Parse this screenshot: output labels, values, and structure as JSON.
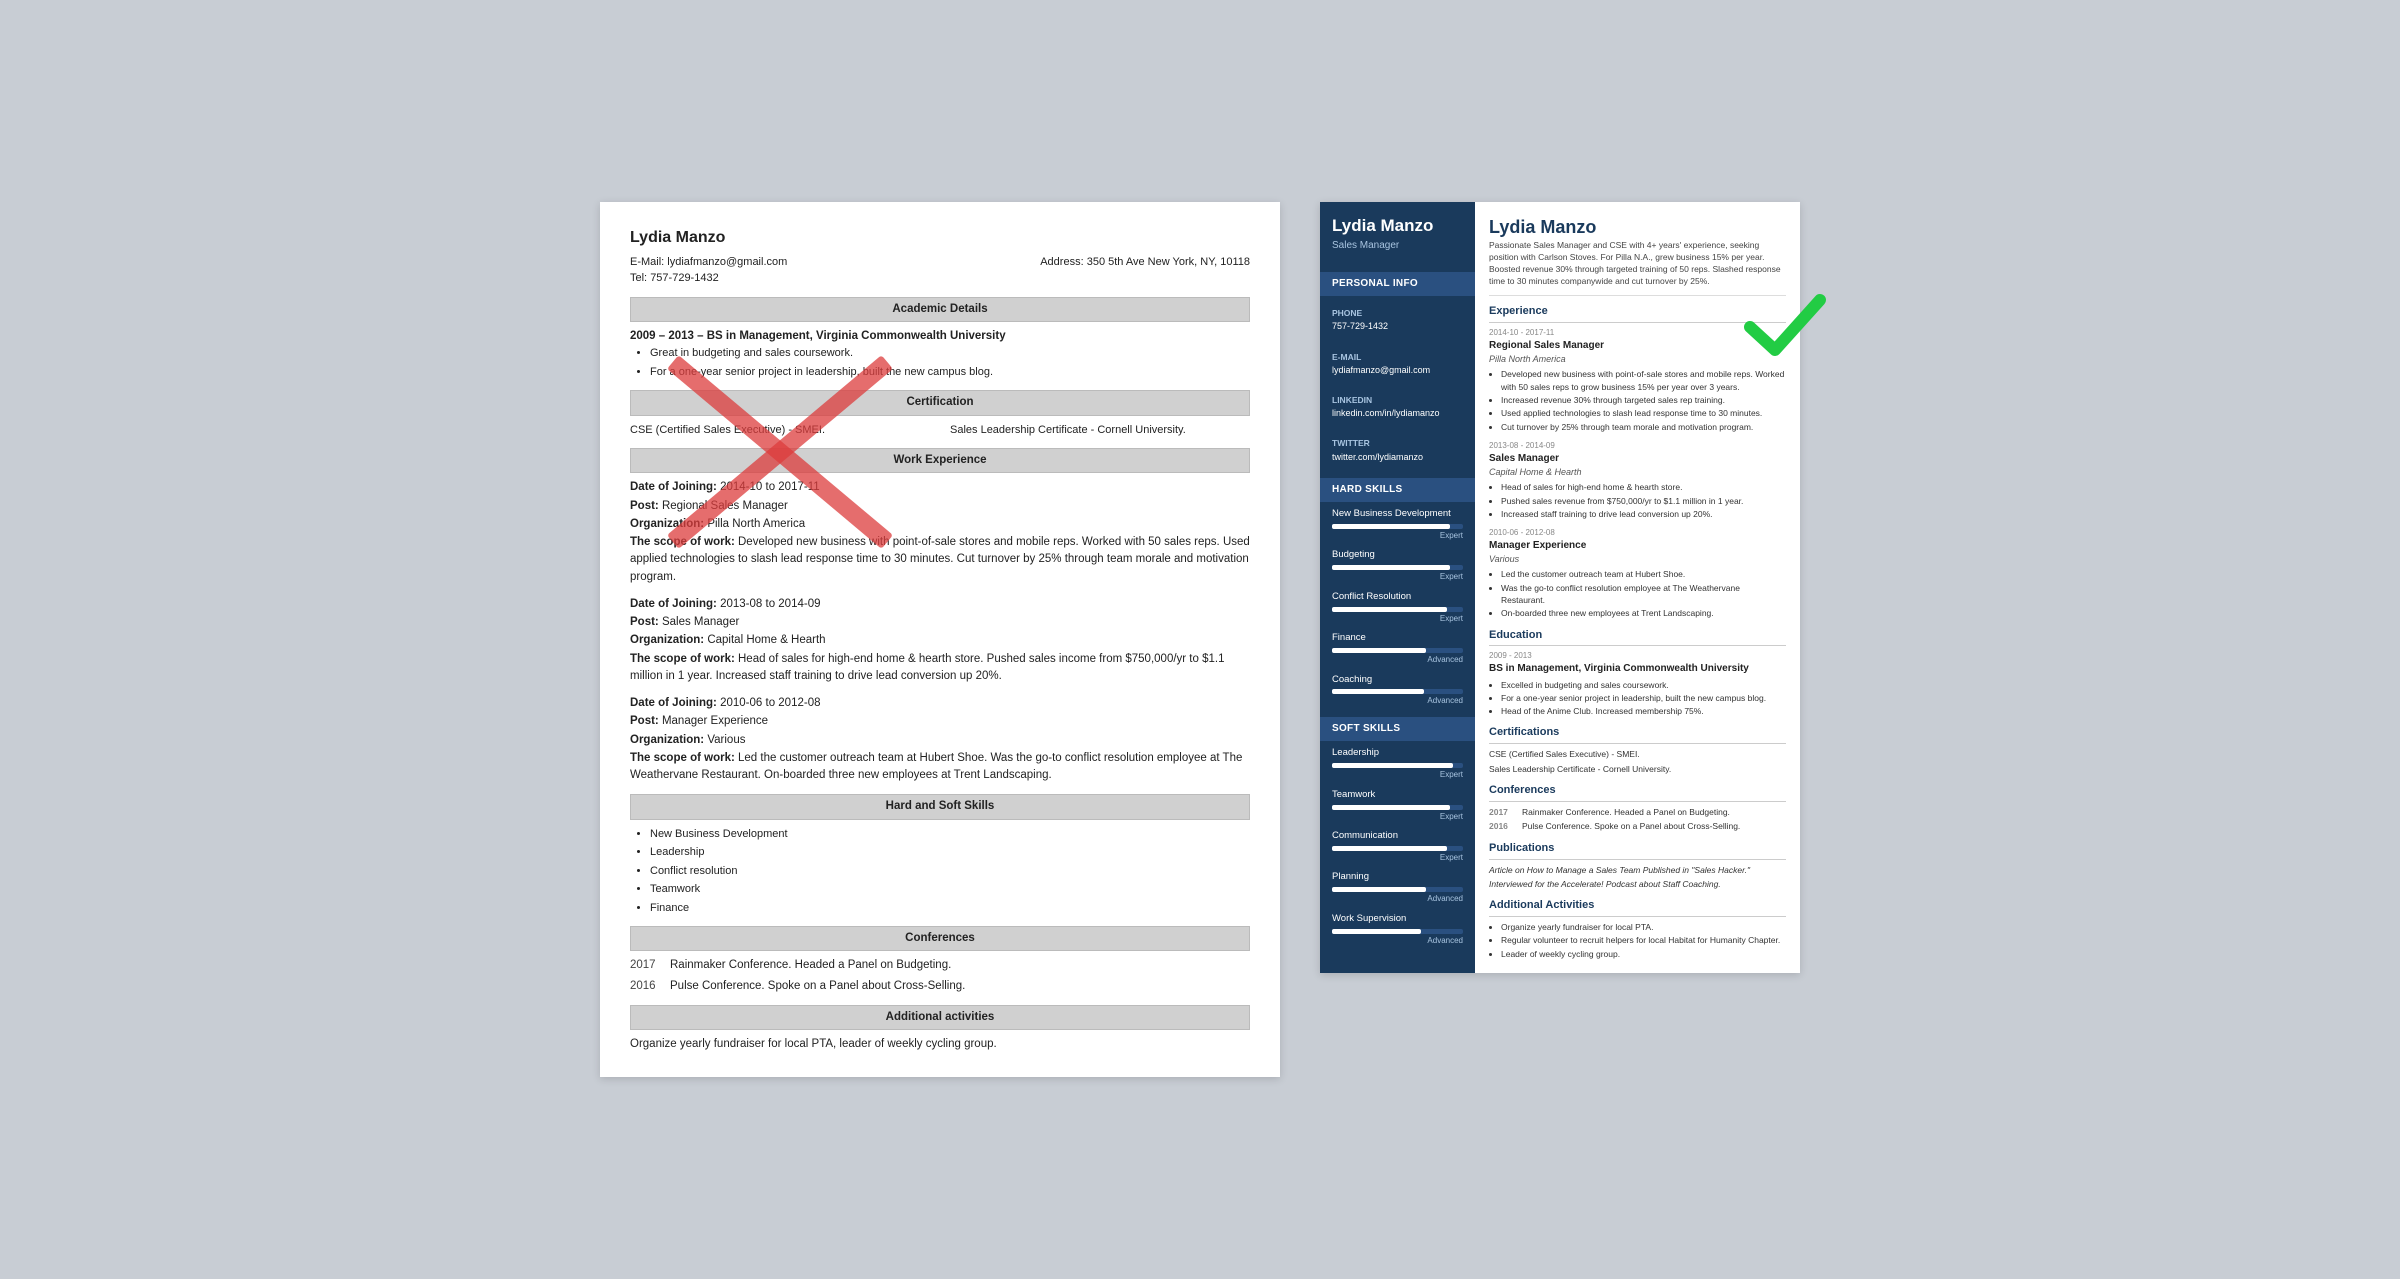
{
  "left_resume": {
    "name": "Lydia Manzo",
    "email_label": "E-Mail:",
    "email": "lydiafmanzo@gmail.com",
    "address_label": "Address:",
    "address": "350 5th Ave New York, NY, 10118",
    "tel_label": "Tel:",
    "tel": "757-729-1432",
    "sections": {
      "academic": "Academic Details",
      "certification": "Certification",
      "work": "Work Experience",
      "skills": "Hard and Soft Skills",
      "conferences": "Conferences",
      "activities": "Additional activities"
    },
    "edu": {
      "dates": "2009 – 2013",
      "degree": "BS in Management, Virginia Commonwealth University",
      "bullets": [
        "Great in budgeting and sales coursework.",
        "For a one-year senior project in leadership, built the new campus blog."
      ]
    },
    "certs": [
      "CSE (Certified Sales Executive) - SMEI.",
      "Sales Leadership Certificate - Cornell University."
    ],
    "work": [
      {
        "date_label": "Date of Joining:",
        "dates": "2014-10 to 2017-11",
        "post_label": "Post:",
        "post": "Regional Sales Manager",
        "org_label": "Organization:",
        "org": "Pilla North America",
        "scope_label": "The scope of work:",
        "scope": "Developed new business with point-of-sale stores and mobile reps. Worked with 50 sales reps. Used applied technologies to slash lead response time to 30 minutes. Cut turnover by 25% through team morale and motivation program."
      },
      {
        "date_label": "Date of Joining:",
        "dates": "2013-08 to 2014-09",
        "post_label": "Post:",
        "post": "Sales Manager",
        "org_label": "Organization:",
        "org": "Capital Home & Hearth",
        "scope_label": "The scope of work:",
        "scope": "Head of sales for high-end home & hearth store. Pushed sales income from $750,000/yr to $1.1 million in 1 year. Increased staff training to drive lead conversion up 20%."
      },
      {
        "date_label": "Date of Joining:",
        "dates": "2010-06 to 2012-08",
        "post_label": "Post:",
        "post": "Manager Experience",
        "org_label": "Organization:",
        "org": "Various",
        "scope_label": "The scope of work:",
        "scope": "Led the customer outreach team at Hubert Shoe. Was the go-to conflict resolution employee at The Weathervane Restaurant. On-boarded three new employees at Trent Landscaping."
      }
    ],
    "skills": [
      "New Business Development",
      "Leadership",
      "Conflict resolution",
      "Teamwork",
      "Finance"
    ],
    "conferences": [
      {
        "year": "2017",
        "desc": "Rainmaker Conference. Headed a Panel on Budgeting."
      },
      {
        "year": "2016",
        "desc": "Pulse Conference. Spoke on a Panel about Cross-Selling."
      }
    ],
    "activity": "Organize yearly fundraiser for local PTA, leader of weekly cycling group."
  },
  "right_resume": {
    "name": "Lydia Manzo",
    "title": "Sales Manager",
    "summary": "Passionate Sales Manager and CSE with 4+ years' experience, seeking position with Carlson Stoves. For Pilla N.A., grew business 15% per year. Boosted revenue 30% through targeted training of 50 reps. Slashed response time to 30 minutes companywide and cut turnover by 25%.",
    "personal_info": {
      "section_title": "Personal Info",
      "phone_label": "Phone",
      "phone": "757-729-1432",
      "email_label": "E-mail",
      "email": "lydiafmanzo@gmail.com",
      "linkedin_label": "LinkedIn",
      "linkedin": "linkedin.com/in/lydiamanzo",
      "twitter_label": "Twitter",
      "twitter": "twitter.com/lydiamanzo"
    },
    "hard_skills": {
      "section_title": "Hard Skills",
      "items": [
        {
          "name": "New Business Development",
          "pct": 90,
          "level": "Expert"
        },
        {
          "name": "Budgeting",
          "pct": 90,
          "level": "Expert"
        },
        {
          "name": "Conflict Resolution",
          "pct": 88,
          "level": "Expert"
        },
        {
          "name": "Finance",
          "pct": 72,
          "level": "Advanced"
        },
        {
          "name": "Coaching",
          "pct": 70,
          "level": "Advanced"
        }
      ]
    },
    "soft_skills": {
      "section_title": "Soft Skills",
      "items": [
        {
          "name": "Leadership",
          "pct": 92,
          "level": "Expert"
        },
        {
          "name": "Teamwork",
          "pct": 90,
          "level": "Expert"
        },
        {
          "name": "Communication",
          "pct": 88,
          "level": "Expert"
        },
        {
          "name": "Planning",
          "pct": 72,
          "level": "Advanced"
        },
        {
          "name": "Work Supervision",
          "pct": 68,
          "level": "Advanced"
        }
      ]
    },
    "experience": {
      "section_title": "Experience",
      "items": [
        {
          "dates": "2014-10 - 2017-11",
          "title": "Regional Sales Manager",
          "company": "Pilla North America",
          "bullets": [
            "Developed new business with point-of-sale stores and mobile reps. Worked with 50 sales reps to grow business 15% per year over 3 years.",
            "Increased revenue 30% through targeted sales rep training.",
            "Used applied technologies to slash lead response time to 30 minutes.",
            "Cut turnover by 25% through team morale and motivation program."
          ]
        },
        {
          "dates": "2013-08 - 2014-09",
          "title": "Sales Manager",
          "company": "Capital Home & Hearth",
          "bullets": [
            "Head of sales for high-end home & hearth store.",
            "Pushed sales revenue from $750,000/yr to $1.1 million in 1 year.",
            "Increased staff training to drive lead conversion up 20%."
          ]
        },
        {
          "dates": "2010-06 - 2012-08",
          "title": "Manager Experience",
          "company": "Various",
          "bullets": [
            "Led the customer outreach team at Hubert Shoe.",
            "Was the go-to conflict resolution employee at The Weathervane Restaurant.",
            "On-boarded three new employees at Trent Landscaping."
          ]
        }
      ]
    },
    "education": {
      "section_title": "Education",
      "items": [
        {
          "dates": "2009 - 2013",
          "degree": "BS in Management, Virginia Commonwealth University",
          "bullets": [
            "Excelled in budgeting and sales coursework.",
            "For a one-year senior project in leadership, built the new campus blog.",
            "Head of the Anime Club. Increased membership 75%."
          ]
        }
      ]
    },
    "certifications": {
      "section_title": "Certifications",
      "items": [
        "CSE (Certified Sales Executive) - SMEI.",
        "Sales Leadership Certificate - Cornell University."
      ]
    },
    "conferences": {
      "section_title": "Conferences",
      "items": [
        {
          "year": "2017",
          "desc": "Rainmaker Conference. Headed a Panel on Budgeting."
        },
        {
          "year": "2016",
          "desc": "Pulse Conference. Spoke on a Panel about Cross-Selling."
        }
      ]
    },
    "publications": {
      "section_title": "Publications",
      "items": [
        "Article on How to Manage a Sales Team Published in \"Sales Hacker.\"",
        "Interviewed for the Accelerate! Podcast about Staff Coaching."
      ]
    },
    "activities": {
      "section_title": "Additional Activities",
      "items": [
        "Organize yearly fundraiser for local PTA.",
        "Regular volunteer to recruit helpers for local Habitat for Humanity Chapter.",
        "Leader of weekly cycling group."
      ]
    }
  }
}
